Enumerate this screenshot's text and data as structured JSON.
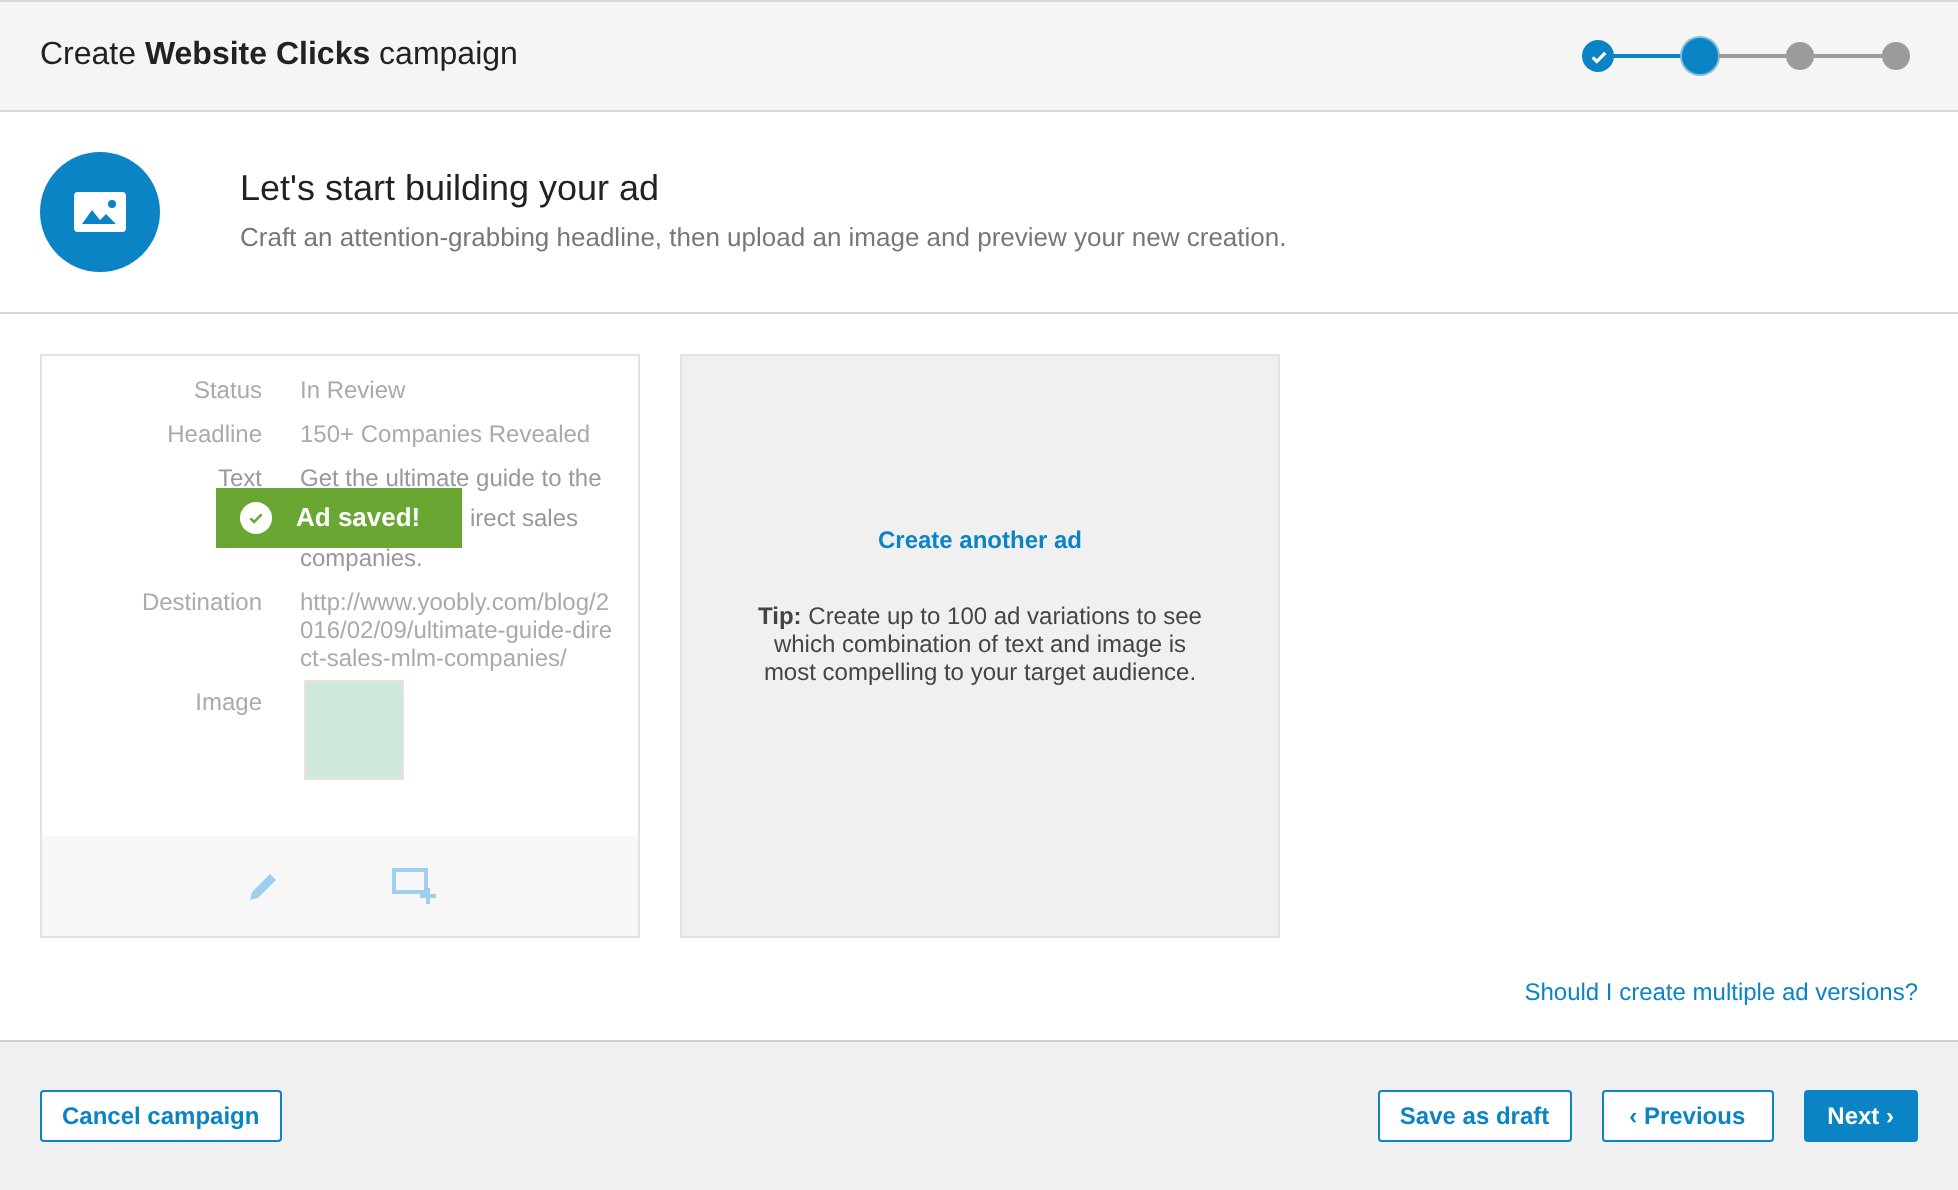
{
  "header": {
    "title": "Create **Website Clicks** campaign",
    "steps": [
      {
        "completed": true,
        "current": false
      },
      {
        "completed": false,
        "current": true
      },
      {
        "completed": false,
        "current": false
      },
      {
        "completed": false,
        "current": false
      }
    ]
  },
  "intro": {
    "heading": "Let's start building your ad",
    "subtitle": "Craft an attention-grabbing headline, then upload an image and preview your new creation."
  },
  "ad_card": {
    "fields": [
      {
        "kind": "text",
        "label": "Status",
        "value": "In Review"
      },
      {
        "kind": "text",
        "label": "Headline",
        "value": "150+ Companies Revealed"
      },
      {
        "kind": "covered",
        "label": "Text",
        "lines": [
          "Get the ultimate guide to the",
          "irect sales",
          "companies."
        ]
      },
      {
        "kind": "text",
        "label": "Destination",
        "value": "http://www.yoobly.com/blog/2016/02/09/ultimate-guide-direct-sales-mlm-companies/"
      },
      {
        "kind": "image",
        "label": "Image"
      }
    ],
    "toast": "Ad saved!"
  },
  "new_ad_card": {
    "link": "Create another ad",
    "tip": "**Tip:** Create up to 100 ad variations to see which combination of text and image is most compelling to your target audience."
  },
  "help_link": "Should I create multiple ad versions?",
  "footer": {
    "cancel": "Cancel campaign",
    "save": "Save as draft",
    "previous": "‹ Previous",
    "next": "Next ›"
  }
}
